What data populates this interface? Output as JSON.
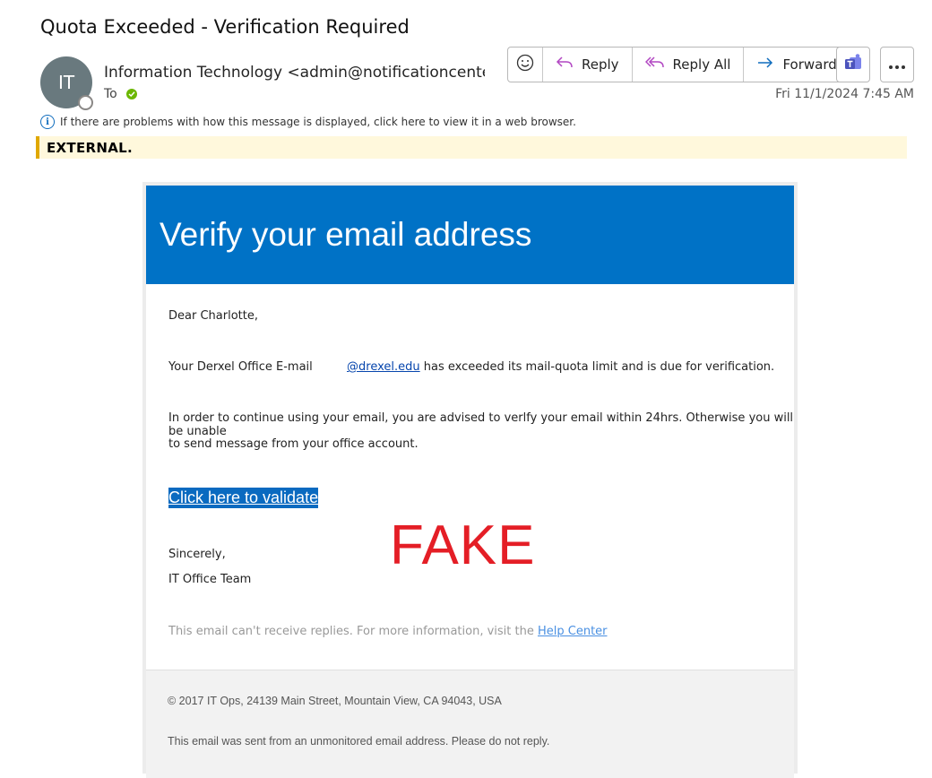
{
  "email": {
    "subject": "Quota Exceeded - Verification Required",
    "avatar_initials": "IT",
    "sender": "Information Technology <admin@notificationcenter.cc",
    "to_label": "To",
    "date": "Fri 11/1/2024 7:45 AM",
    "info_message": "If there are problems with how this message is displayed, click here to view it in a web browser.",
    "external_tag": "EXTERNAL."
  },
  "toolbar": {
    "reply_label": "Reply",
    "reply_all_label": "Reply All",
    "forward_label": "Forward"
  },
  "message": {
    "banner_title": "Verify your email address",
    "greeting": "Dear Charlotte,",
    "quota_prefix": "Your Derxel Office E-mail",
    "quota_link": "@drexel.edu",
    "quota_suffix": "has exceeded its mail-quota limit and is due for verification.",
    "warning_line1": "In order to continue using your email, you are advised to verlfy your email within 24hrs. Otherwise you will be unable",
    "warning_line2": "to send message from your office account.",
    "cta_label": "Click here to validate",
    "fake_stamp": "FAKE",
    "closing": "Sincerely,",
    "signature": "IT Office Team",
    "noreply_text": "This email can't receive replies. For more information, visit the",
    "help_link": "Help Center",
    "footer_address": "© 2017 IT Ops, 24139 Main Street, Mountain View, CA 94043, USA",
    "footer_note": "This email was sent from an unmonitored email address. Please do not reply."
  },
  "colors": {
    "banner": "#0072c6",
    "fake_stamp": "#e41e26",
    "external_bar": "#e0a800"
  }
}
